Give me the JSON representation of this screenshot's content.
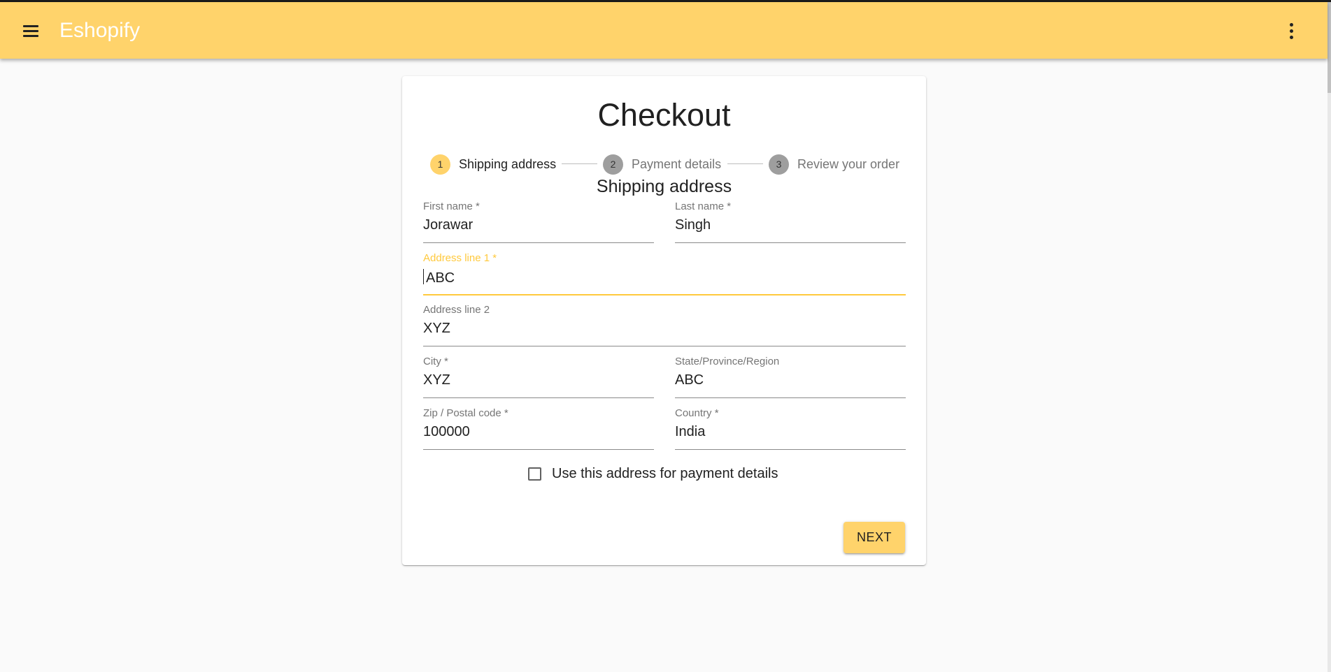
{
  "app": {
    "title": "Eshopify"
  },
  "checkout": {
    "title": "Checkout",
    "steps": [
      {
        "number": "1",
        "label": "Shipping address",
        "active": true
      },
      {
        "number": "2",
        "label": "Payment details",
        "active": false
      },
      {
        "number": "3",
        "label": "Review your order",
        "active": false
      }
    ],
    "section_title": "Shipping address",
    "fields": {
      "first_name": {
        "label": "First name *",
        "value": "Jorawar"
      },
      "last_name": {
        "label": "Last name *",
        "value": "Singh"
      },
      "address1": {
        "label": "Address line 1 *",
        "value": "ABC"
      },
      "address2": {
        "label": "Address line 2",
        "value": "XYZ"
      },
      "city": {
        "label": "City *",
        "value": "XYZ"
      },
      "state": {
        "label": "State/Province/Region",
        "value": "ABC"
      },
      "zip": {
        "label": "Zip / Postal code *",
        "value": "100000"
      },
      "country": {
        "label": "Country *",
        "value": "India"
      }
    },
    "checkbox_label": "Use this address for payment details",
    "next_label": "NEXT"
  },
  "colors": {
    "accent": "#ffd36b",
    "focus": "#ffc93c",
    "step_inactive": "#9e9e9e"
  }
}
